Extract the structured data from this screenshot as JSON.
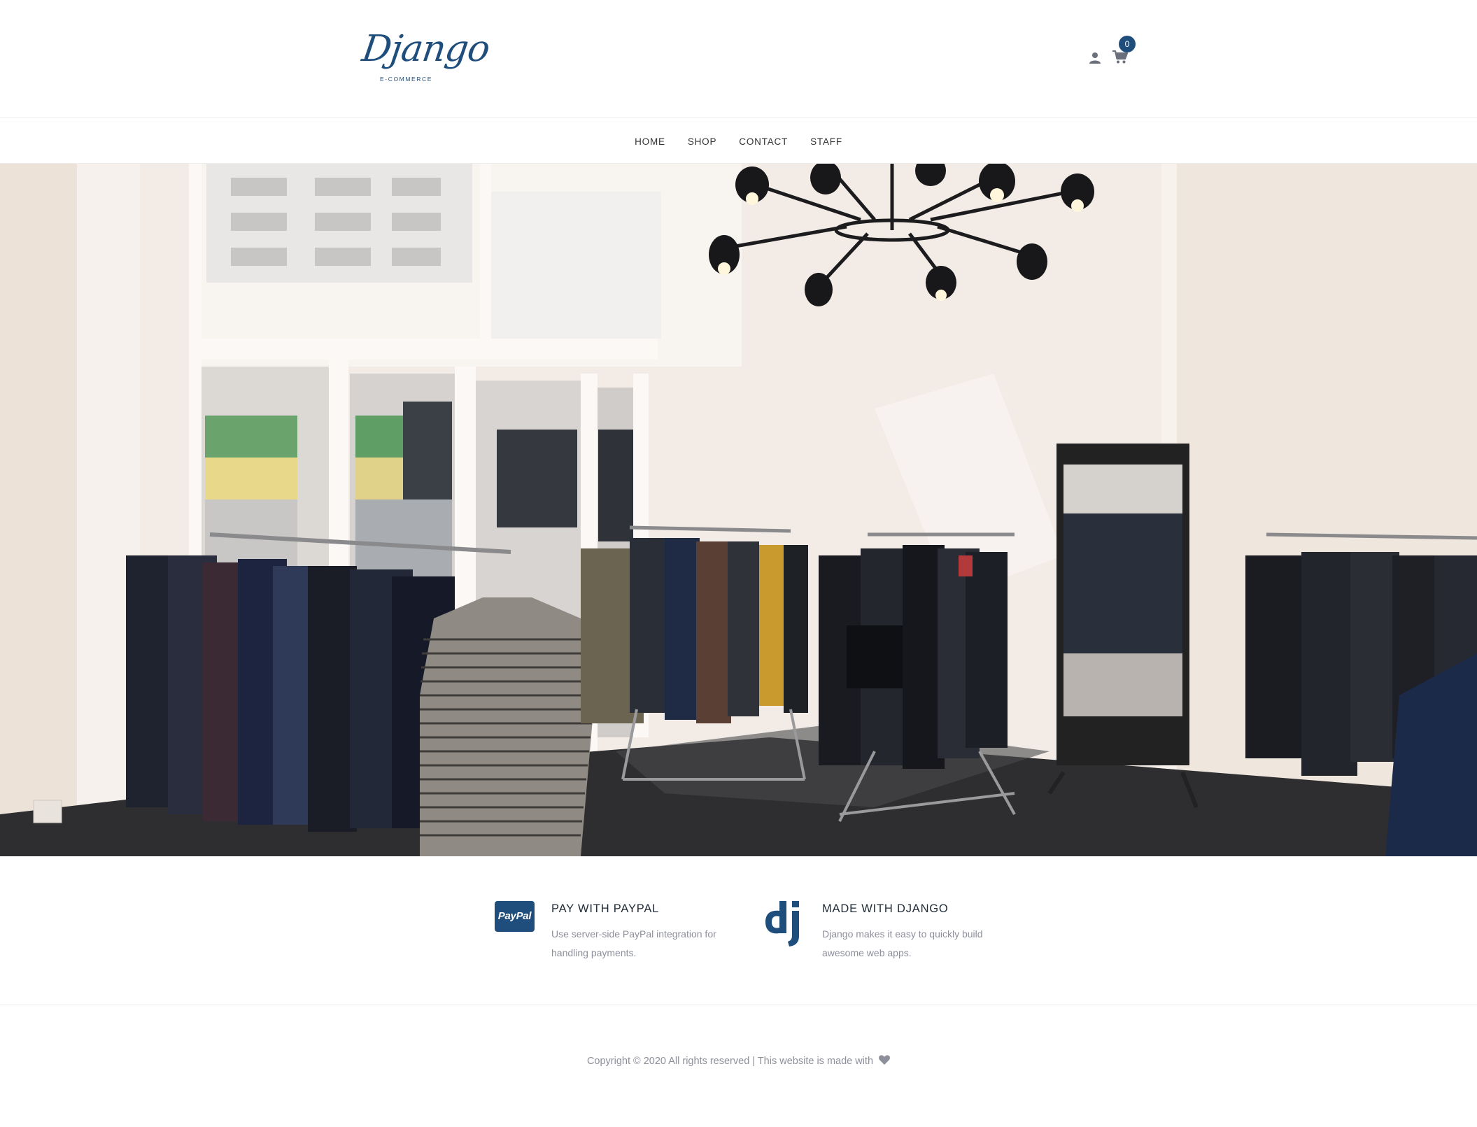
{
  "header": {
    "logo_text": "Django",
    "logo_subtext": "E-COMMERCE",
    "cart_count": "0",
    "icons": [
      "user-icon",
      "cart-icon"
    ]
  },
  "nav": {
    "items": [
      {
        "label": "HOME"
      },
      {
        "label": "SHOP"
      },
      {
        "label": "CONTACT"
      },
      {
        "label": "STAFF"
      }
    ]
  },
  "features": [
    {
      "icon": "paypal-icon",
      "icon_text": "PayPal",
      "title": "PAY WITH PAYPAL",
      "description": "Use server-side PayPal integration for handling payments."
    },
    {
      "icon": "django-icon",
      "title": "MADE WITH DJANGO",
      "description": "Django makes it easy to quickly build awesome web apps."
    }
  ],
  "footer": {
    "copyright": "Copyright © 2020 All rights reserved | This website is made with",
    "icon": "heart-icon"
  },
  "colors": {
    "brand": "#1f4e7c",
    "muted_text": "#8d8f9b",
    "border": "#ececec"
  }
}
